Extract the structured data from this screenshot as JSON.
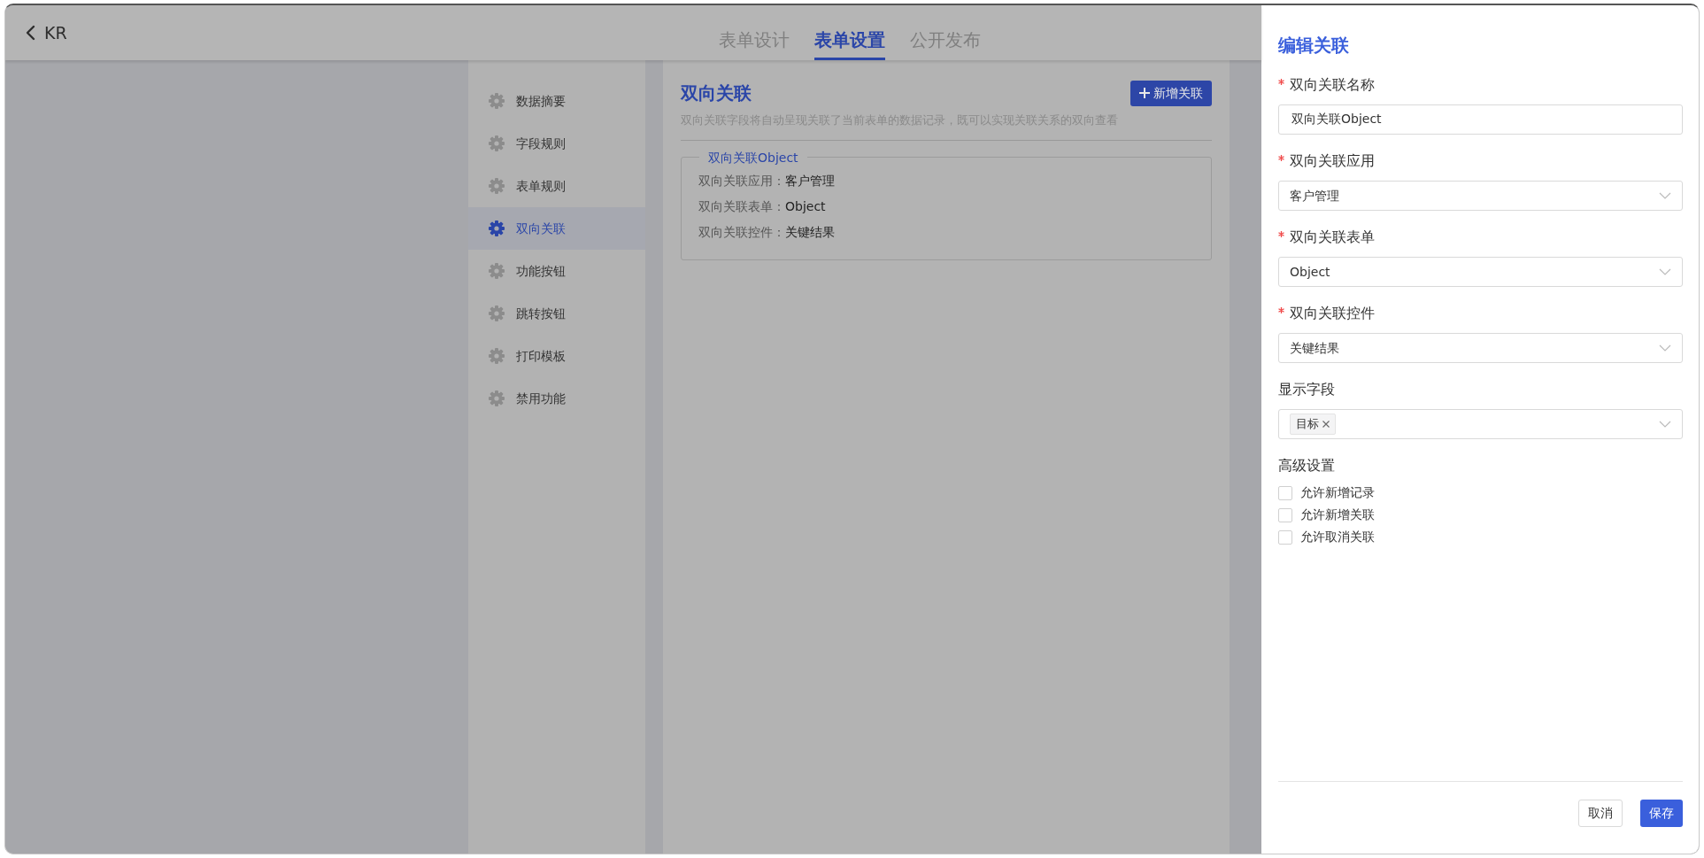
{
  "header": {
    "back_label": "KR",
    "tabs": [
      {
        "label": "表单设计",
        "selected": false
      },
      {
        "label": "表单设置",
        "selected": true
      },
      {
        "label": "公开发布",
        "selected": false
      }
    ]
  },
  "sidebar": {
    "items": [
      {
        "label": "数据摘要",
        "selected": false
      },
      {
        "label": "字段规则",
        "selected": false
      },
      {
        "label": "表单规则",
        "selected": false
      },
      {
        "label": "双向关联",
        "selected": true
      },
      {
        "label": "功能按钮",
        "selected": false
      },
      {
        "label": "跳转按钮",
        "selected": false
      },
      {
        "label": "打印模板",
        "selected": false
      },
      {
        "label": "禁用功能",
        "selected": false
      }
    ]
  },
  "section": {
    "title": "双向关联",
    "add_button": "新增关联",
    "description": "双向关联字段将自动呈现关联了当前表单的数据记录，既可以实现关联关系的双向查看",
    "card": {
      "legend": "双向关联Object",
      "rows": [
        {
          "label": "双向关联应用：",
          "value": "客户管理"
        },
        {
          "label": "双向关联表单：",
          "value": "Object"
        },
        {
          "label": "双向关联控件：",
          "value": "关键结果"
        }
      ]
    }
  },
  "drawer": {
    "title": "编辑关联",
    "fields": [
      {
        "kind": "input",
        "label": "双向关联名称",
        "required": true,
        "value": "双向关联Object"
      },
      {
        "kind": "select",
        "label": "双向关联应用",
        "required": true,
        "value": "客户管理"
      },
      {
        "kind": "select",
        "label": "双向关联表单",
        "required": true,
        "value": "Object"
      },
      {
        "kind": "select",
        "label": "双向关联控件",
        "required": true,
        "value": "关键结果"
      },
      {
        "kind": "tags",
        "label": "显示字段",
        "required": false,
        "tags": [
          "目标"
        ]
      }
    ],
    "advanced_label": "高级设置",
    "options": [
      {
        "label": "允许新增记录",
        "checked": false
      },
      {
        "label": "允许新增关联",
        "checked": false
      },
      {
        "label": "允许取消关联",
        "checked": false
      }
    ],
    "cancel_button": "取消",
    "save_button": "保存"
  }
}
